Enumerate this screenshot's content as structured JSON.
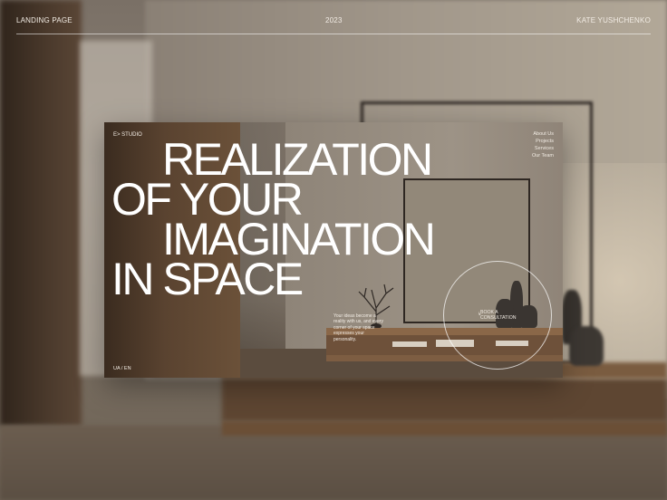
{
  "header": {
    "left": "LANDING PAGE",
    "center": "2023",
    "right": "KATE YUSHCHENKO"
  },
  "card": {
    "logo": "E> STUDIO",
    "nav": [
      "About Us",
      "Projects",
      "Services",
      "Our Team"
    ],
    "headline": [
      "REALIZATION",
      "OF YOUR",
      "IMAGINATION",
      "IN SPACE"
    ],
    "description": "Your ideas become a reality with us, and every corner of your space expresses your personality.",
    "cta": {
      "line1": "BOOK A",
      "line2": "CONSULTATION"
    },
    "lang": "UA / EN"
  },
  "colors": {
    "text": "#f2ece4",
    "headline": "#ffffff"
  },
  "icons": [
    "arrow-right-icon",
    "branch-decor"
  ]
}
